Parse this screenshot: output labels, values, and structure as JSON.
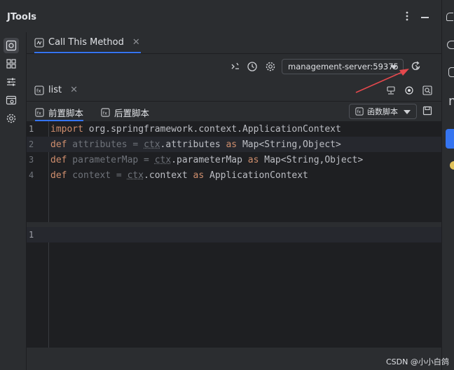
{
  "app": {
    "title": "JTools"
  },
  "main_tab": {
    "label": "Call This Method"
  },
  "toolbar": {
    "server_select_value": "management-server:59375"
  },
  "sub_tab": {
    "label": "list"
  },
  "script_tabs": [
    {
      "label": "前置脚本"
    },
    {
      "label": "后置脚本"
    }
  ],
  "function_button": {
    "label": "函数脚本"
  },
  "editor_pre": {
    "line_numbers": [
      "1",
      "2",
      "3",
      "4"
    ],
    "lines": [
      [
        {
          "t": "import",
          "c": "kw"
        },
        {
          "t": " org.springframework.context.ApplicationContext",
          "c": "id"
        }
      ],
      [
        {
          "t": "def",
          "c": "kw"
        },
        {
          "t": " attributes = ",
          "c": "pm"
        },
        {
          "t": "ctx",
          "c": "ctx"
        },
        {
          "t": ".attributes ",
          "c": "id"
        },
        {
          "t": "as",
          "c": "kw"
        },
        {
          "t": " Map<String,Object>",
          "c": "id"
        }
      ],
      [
        {
          "t": "def",
          "c": "kw"
        },
        {
          "t": " parameterMap = ",
          "c": "pm"
        },
        {
          "t": "ctx",
          "c": "ctx"
        },
        {
          "t": ".parameterMap ",
          "c": "id"
        },
        {
          "t": "as",
          "c": "kw"
        },
        {
          "t": " Map<String,Object>",
          "c": "id"
        }
      ],
      [
        {
          "t": "def",
          "c": "kw"
        },
        {
          "t": " context = ",
          "c": "pm"
        },
        {
          "t": "ctx",
          "c": "ctx"
        },
        {
          "t": ".context ",
          "c": "id"
        },
        {
          "t": "as",
          "c": "kw"
        },
        {
          "t": " ApplicationContext",
          "c": "id"
        }
      ]
    ]
  },
  "editor_post": {
    "line_numbers": [
      "1"
    ]
  },
  "watermark": {
    "text": "CSDN @小小白鸽"
  },
  "colors": {
    "accent": "#3574f0",
    "arrow": "#e5484d",
    "keyword": "#cf8e6d"
  }
}
